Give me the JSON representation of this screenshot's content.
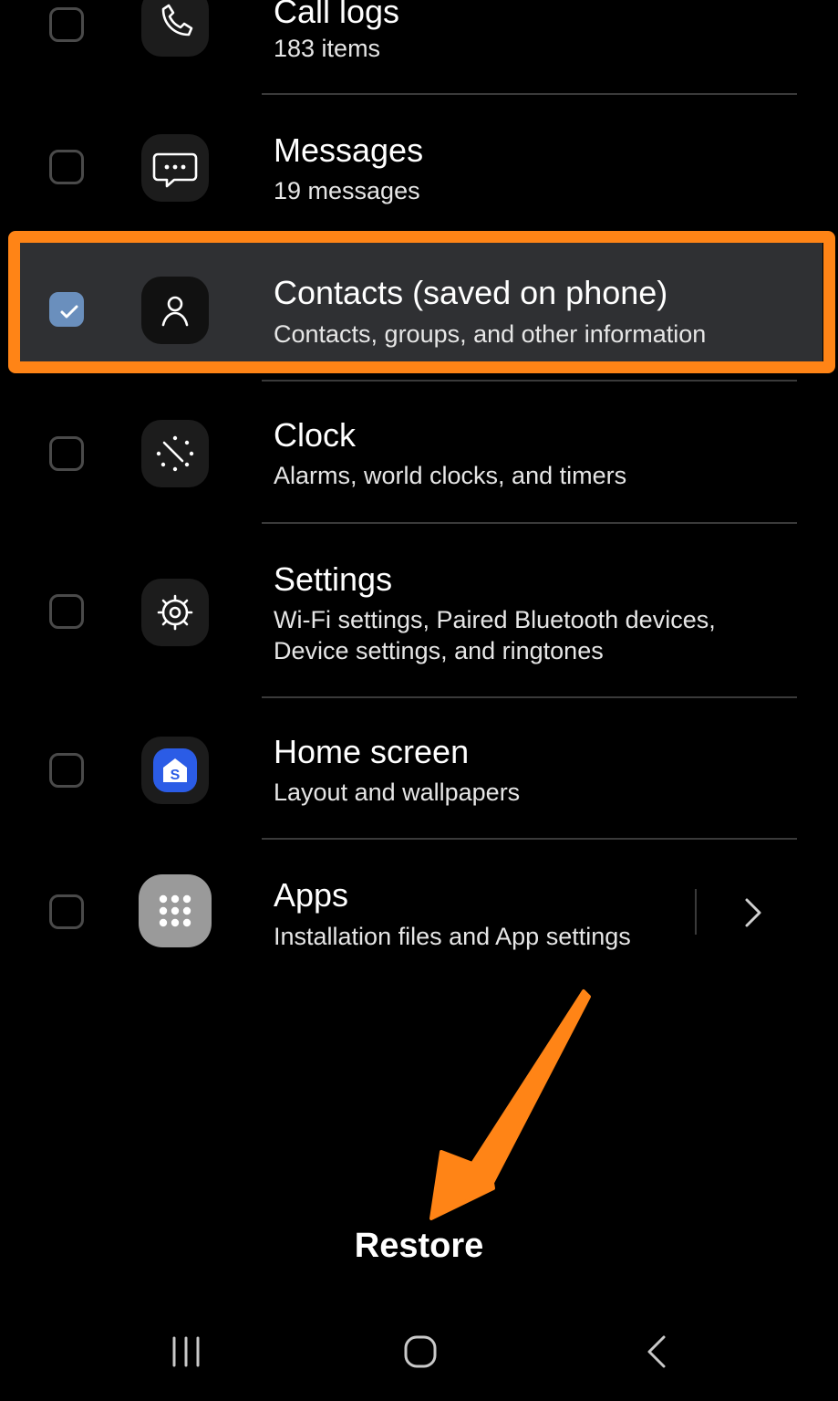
{
  "items": [
    {
      "title": "Call logs",
      "subtitle": "183 items",
      "checked": false,
      "icon": "phone-icon"
    },
    {
      "title": "Messages",
      "subtitle": "19 messages",
      "checked": false,
      "icon": "chat-bubble-icon"
    },
    {
      "title": "Contacts (saved on phone)",
      "subtitle": "Contacts, groups, and other information",
      "checked": true,
      "icon": "person-icon"
    },
    {
      "title": "Clock",
      "subtitle": "Alarms, world clocks, and timers",
      "checked": false,
      "icon": "clock-icon"
    },
    {
      "title": "Settings",
      "subtitle_line1": "Wi-Fi settings, Paired Bluetooth devices,",
      "subtitle_line2": "Device settings, and ringtones",
      "checked": false,
      "icon": "gear-icon"
    },
    {
      "title": "Home screen",
      "subtitle": "Layout and wallpapers",
      "checked": false,
      "icon": "home-s-icon"
    },
    {
      "title": "Apps",
      "subtitle": "Installation files and App settings",
      "checked": false,
      "icon": "apps-grid-icon"
    }
  ],
  "restore_label": "Restore",
  "navbar": {
    "recents_icon": "recents-icon",
    "home_icon": "home-icon",
    "back_icon": "back-icon"
  },
  "colors": {
    "highlight": "#ff8416",
    "checked": "#6a8fbd",
    "home_icon_blue": "#2b5ce6",
    "background": "#000000"
  }
}
